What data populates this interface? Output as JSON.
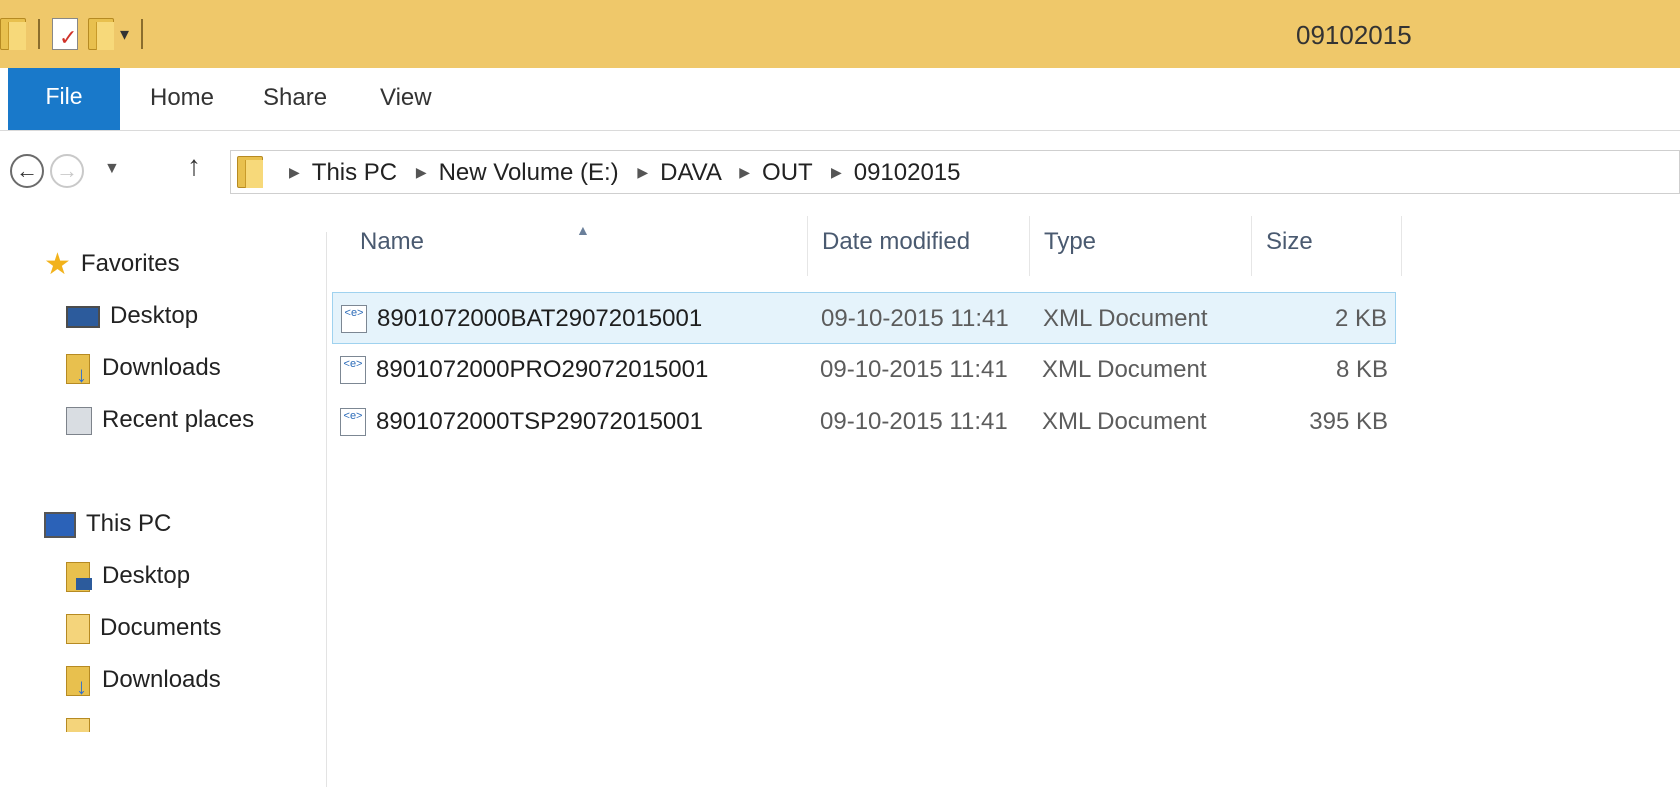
{
  "window": {
    "title": "09102015",
    "quick_access": [
      "folder-icon",
      "properties-icon",
      "new-folder-icon",
      "customize-dropdown-icon"
    ]
  },
  "ribbon": {
    "tabs": [
      {
        "label": "File"
      },
      {
        "label": "Home"
      },
      {
        "label": "Share"
      },
      {
        "label": "View"
      }
    ],
    "colors": {
      "file_tab": "#1979ca",
      "titlebar": "#efc86a"
    }
  },
  "address": {
    "crumbs": [
      "This PC",
      "New Volume (E:)",
      "DAVA",
      "OUT",
      "09102015"
    ]
  },
  "navpane": {
    "favorites_label": "Favorites",
    "favorites": [
      "Desktop",
      "Downloads",
      "Recent places"
    ],
    "thispc_label": "This PC",
    "thispc": [
      "Desktop",
      "Documents",
      "Downloads"
    ]
  },
  "filelist": {
    "columns": {
      "name": "Name",
      "date": "Date modified",
      "type": "Type",
      "size": "Size"
    },
    "sorted_by": "Name",
    "files": [
      {
        "name": "8901072000BAT29072015001",
        "date": "09-10-2015 11:41",
        "type": "XML Document",
        "size": "2 KB",
        "selected": true
      },
      {
        "name": "8901072000PRO29072015001",
        "date": "09-10-2015 11:41",
        "type": "XML Document",
        "size": "8 KB",
        "selected": false
      },
      {
        "name": "8901072000TSP29072015001",
        "date": "09-10-2015 11:41",
        "type": "XML Document",
        "size": "395 KB",
        "selected": false
      }
    ]
  }
}
